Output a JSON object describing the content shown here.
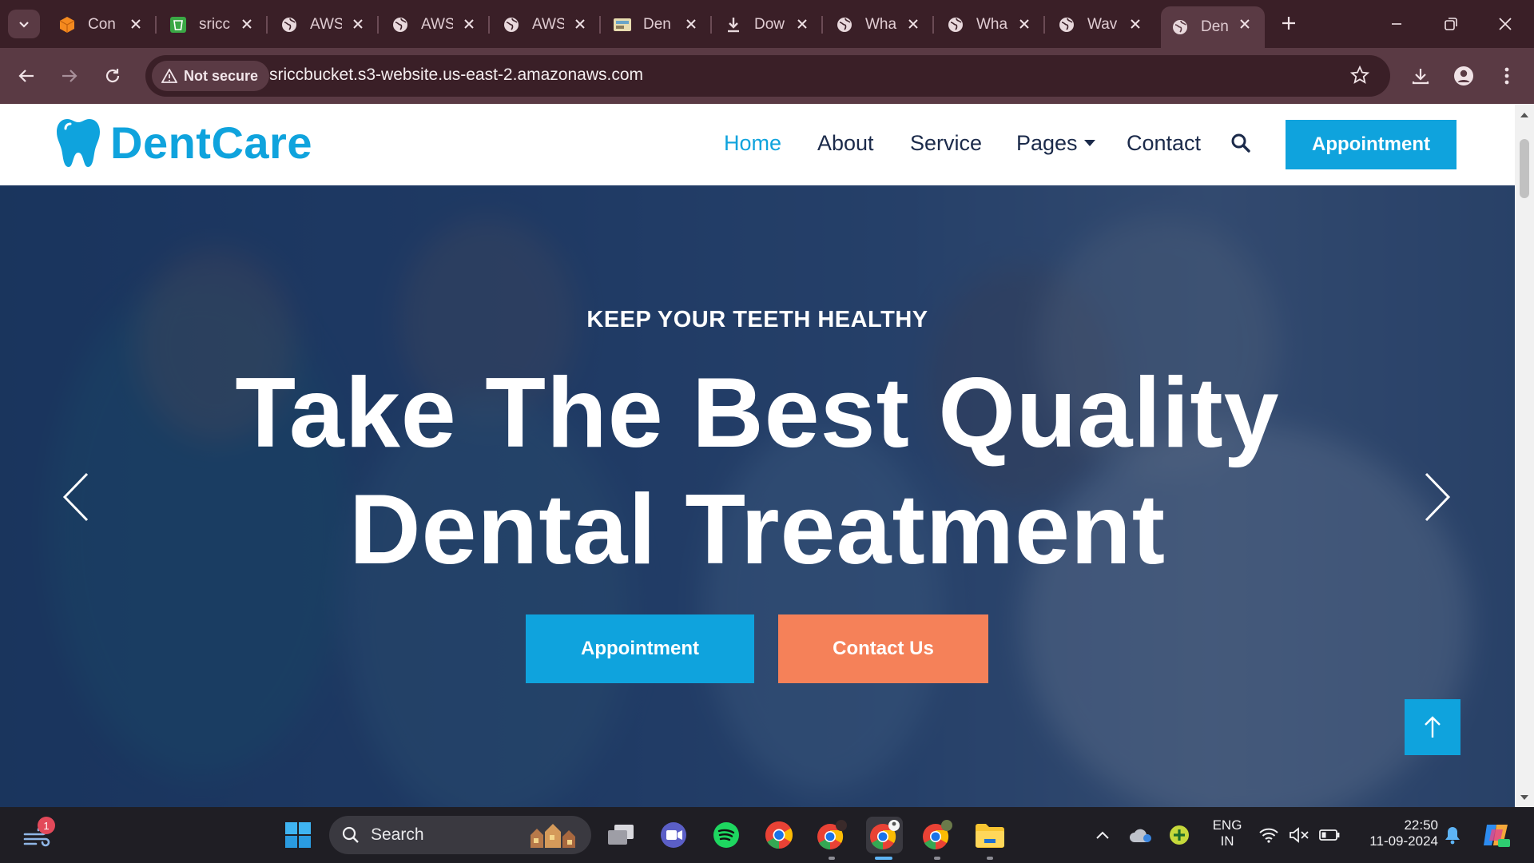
{
  "browser": {
    "tabs": [
      {
        "title": "Con",
        "icon": "aws-box-icon",
        "color": "#f58a1f"
      },
      {
        "title": "sricc",
        "icon": "s3-bucket-icon",
        "color": "#3aa845"
      },
      {
        "title": "AWS",
        "icon": "globe-icon"
      },
      {
        "title": "AWS",
        "icon": "globe-icon"
      },
      {
        "title": "AWS",
        "icon": "globe-icon"
      },
      {
        "title": "Den",
        "icon": "image-icon"
      },
      {
        "title": "Dow",
        "icon": "download-icon"
      },
      {
        "title": "Wha",
        "icon": "globe-icon"
      },
      {
        "title": "Wha",
        "icon": "globe-icon"
      },
      {
        "title": "Wav",
        "icon": "globe-icon"
      },
      {
        "title": "Den",
        "icon": "globe-icon",
        "active": true
      }
    ],
    "security_chip": "Not secure",
    "url": "sriccbucket.s3-website.us-east-2.amazonaws.com"
  },
  "site": {
    "brand": "DentCare",
    "brand_color": "#0fa3dd",
    "nav": {
      "home": "Home",
      "about": "About",
      "service": "Service",
      "pages": "Pages",
      "contact": "Contact",
      "appointment": "Appointment"
    },
    "hero": {
      "eyebrow": "KEEP YOUR TEETH HEALTHY",
      "title_line1": "Take The Best Quality",
      "title_line2": "Dental Treatment",
      "primary_button": "Appointment",
      "secondary_button": "Contact Us",
      "primary_color": "#0fa3dd",
      "secondary_color": "#f58159"
    }
  },
  "taskbar": {
    "search_placeholder": "Search",
    "notification_count": "1",
    "language_line1": "ENG",
    "language_line2": "IN",
    "time": "22:50",
    "date": "11-09-2024"
  }
}
